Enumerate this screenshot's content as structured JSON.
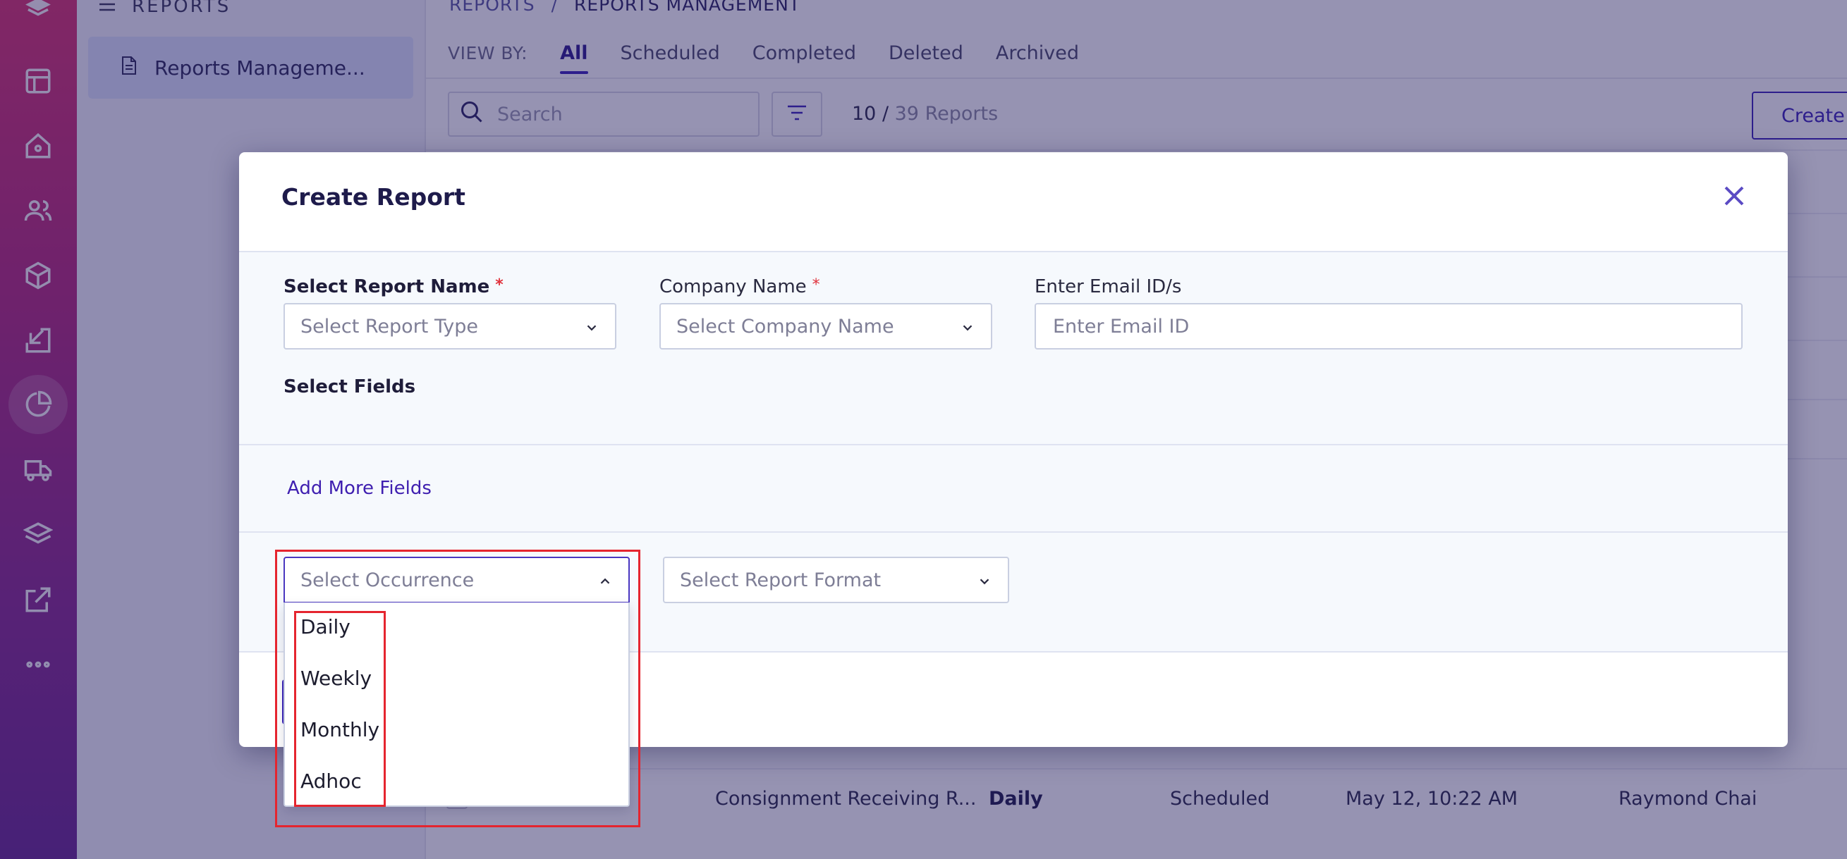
{
  "app": {
    "section_heading": "REPORTS",
    "sidebar_item": "Reports Manageme...",
    "breadcrumb": {
      "parent": "REPORTS",
      "separator": "/",
      "current": "REPORTS MANAGEMENT"
    },
    "view_by_label": "VIEW BY:",
    "tabs": [
      "All",
      "Scheduled",
      "Completed",
      "Deleted",
      "Archived"
    ],
    "active_tab": "All",
    "search_placeholder": "Search",
    "count": {
      "shown": "10",
      "separator": " / ",
      "total": "39 Reports"
    },
    "create_button": "Create N",
    "visible_row": {
      "name": "Consignment Receiving R...",
      "occurrence": "Daily",
      "status": "Scheduled",
      "date": "May 12, 10:22 AM",
      "owner": "Raymond Chai"
    }
  },
  "modal": {
    "title": "Create Report",
    "fields": {
      "report_name": {
        "label": "Select Report Name",
        "required_mark": "*",
        "placeholder": "Select Report Type"
      },
      "company_name": {
        "label": "Company Name",
        "required_mark": "*",
        "placeholder": "Select Company Name"
      },
      "email": {
        "label": "Enter Email ID/s",
        "placeholder": "Enter Email ID"
      },
      "select_fields_label": "Select Fields",
      "add_more_fields": "Add More Fields",
      "occurrence": {
        "placeholder": "Select Occurrence",
        "options": [
          "Daily",
          "Weekly",
          "Monthly",
          "Adhoc"
        ]
      },
      "report_format": {
        "placeholder": "Select Report Format"
      }
    }
  },
  "colors": {
    "accent": "#3a23b8",
    "required": "#e0323c",
    "highlight": "#e5252f"
  }
}
